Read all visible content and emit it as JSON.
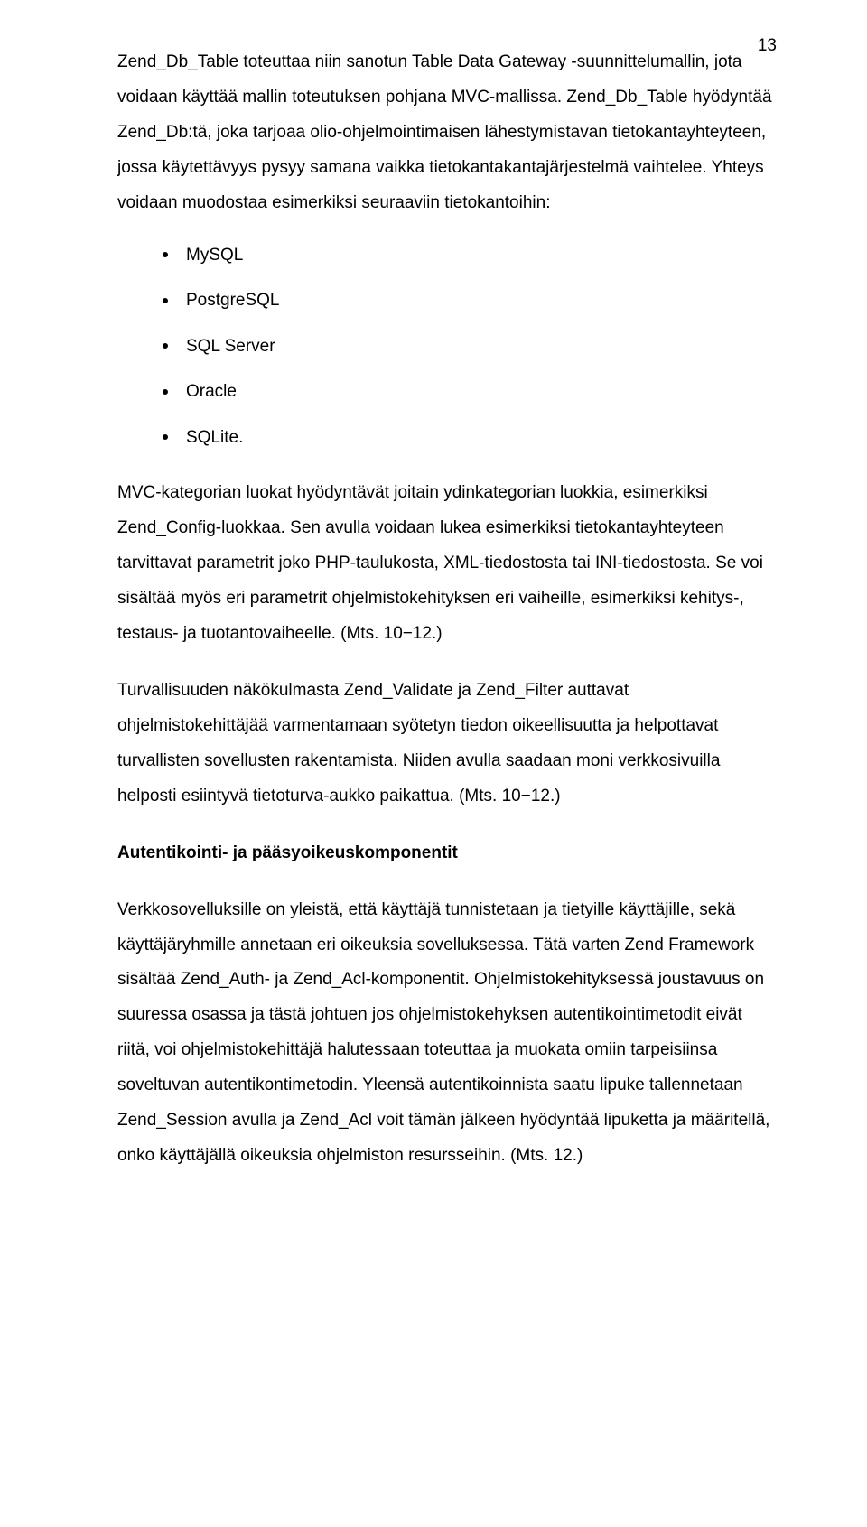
{
  "page_number": "13",
  "paragraphs": {
    "p1": "Zend_Db_Table toteuttaa niin sanotun Table Data Gateway -suunnittelumallin, jota voidaan käyttää mallin toteutuksen pohjana MVC-mallissa. Zend_Db_Table hyödyntää Zend_Db:tä, joka tarjoaa olio-ohjelmointimaisen lähestymistavan tietokantayhteyteen, jossa käytettävyys pysyy samana vaikka tietokantakantajärjestelmä vaihtelee. Yhteys voidaan muodostaa esimerkiksi seuraaviin tietokantoihin:",
    "p2": "MVC-kategorian luokat hyödyntävät joitain ydinkategorian luokkia, esimerkiksi Zend_Config-luokkaa. Sen avulla voidaan lukea esimerkiksi tietokantayhteyteen tarvittavat parametrit joko PHP-taulukosta, XML-tiedostosta tai INI-tiedostosta. Se voi sisältää myös eri parametrit ohjelmistokehityksen eri vaiheille, esimerkiksi kehitys-, testaus- ja tuotantovaiheelle. (Mts. 10−12.)",
    "p3": "Turvallisuuden näkökulmasta Zend_Validate ja Zend_Filter auttavat ohjelmistokehittäjää varmentamaan syötetyn tiedon oikeellisuutta ja helpottavat turvallisten sovellusten rakentamista. Niiden avulla saadaan moni verkkosivuilla helposti esiintyvä tietoturva-aukko paikattua. (Mts. 10−12.)",
    "h1": "Autentikointi- ja pääsyoikeuskomponentit",
    "p4": "Verkkosovelluksille on yleistä, että käyttäjä tunnistetaan ja tietyille käyttäjille, sekä käyttäjäryhmille annetaan eri oikeuksia sovelluksessa. Tätä varten Zend Framework sisältää Zend_Auth- ja Zend_Acl-komponentit. Ohjelmistokehityksessä joustavuus on suuressa osassa ja tästä johtuen jos ohjelmistokehyksen autentikointimetodit eivät riitä, voi ohjelmistokehittäjä halutessaan toteuttaa ja muokata omiin tarpeisiinsa soveltuvan autentikontimetodin. Yleensä autentikoinnista saatu lipuke tallennetaan Zend_Session avulla ja Zend_Acl voit tämän jälkeen hyödyntää lipuketta ja määritellä, onko käyttäjällä oikeuksia ohjelmiston resursseihin. (Mts. 12.)"
  },
  "db_list": {
    "items": [
      "MySQL",
      "PostgreSQL",
      "SQL Server",
      "Oracle",
      "SQLite."
    ]
  }
}
